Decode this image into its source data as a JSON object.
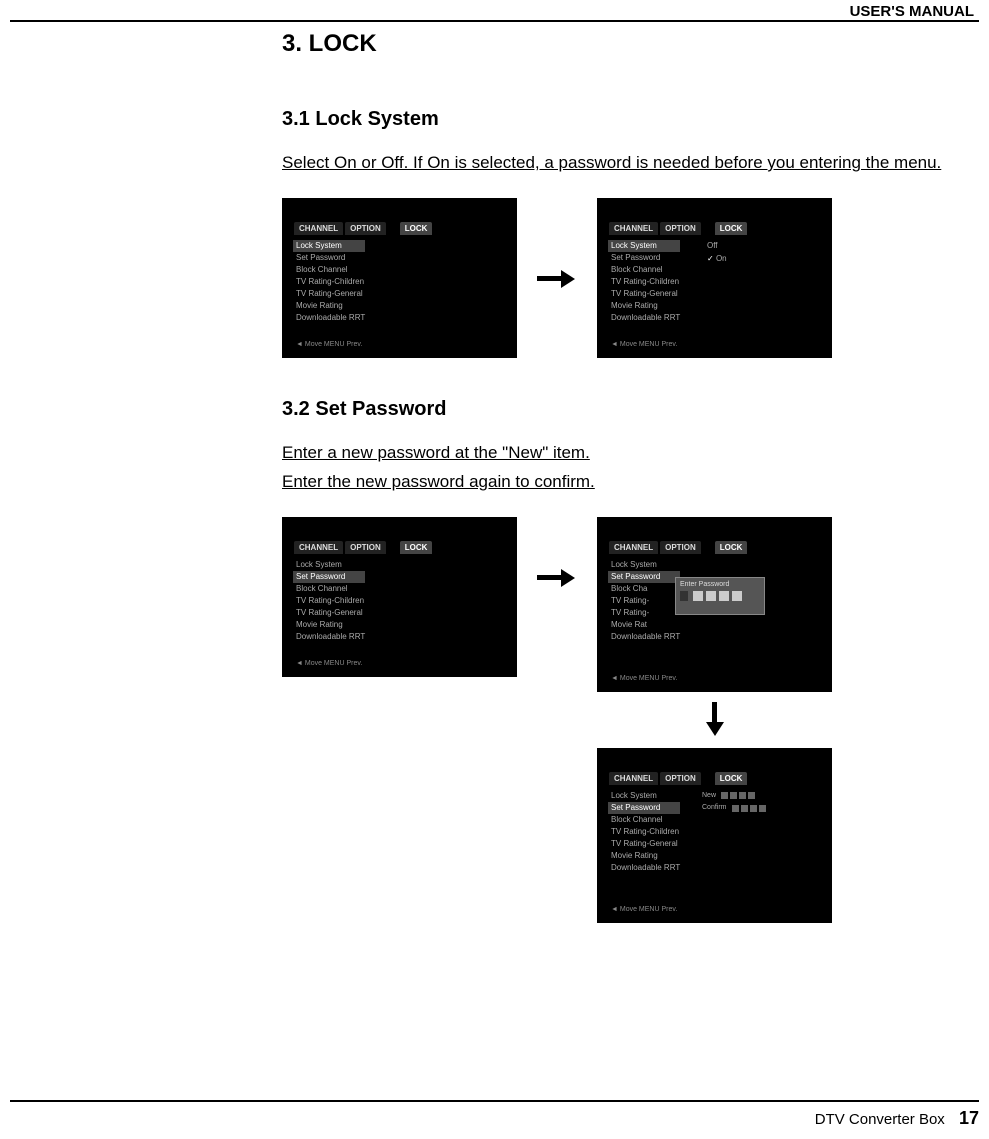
{
  "header": {
    "manual_label": "USER'S MANUAL"
  },
  "section": {
    "title": "3. LOCK",
    "sub1": {
      "title": "3.1 Lock System",
      "desc": "Select On or Off. If On is selected, a password is needed before you entering the menu."
    },
    "sub2": {
      "title": "3.2 Set Password",
      "desc1": "Enter a new password at the \"New\" item.",
      "desc2": "Enter the new password again to confirm."
    }
  },
  "tv_menu": {
    "tabs": {
      "channel": "CHANNEL",
      "option": "OPTION",
      "lock": "LOCK"
    },
    "items": {
      "lock_system": "Lock System",
      "set_password": "Set Password",
      "block_channel": "Block Channel",
      "tv_rating_children": "TV Rating-Children",
      "tv_rating_general": "TV Rating-General",
      "movie_rating": "Movie Rating",
      "downloadable": "Downloadable RRT"
    },
    "options": {
      "off": "Off",
      "on": "On",
      "check": "✓"
    },
    "popup": {
      "title": "Enter Password"
    },
    "confirm_panel": {
      "new": "New",
      "confirm": "Confirm"
    },
    "hint": "◄ Move  MENU Prev."
  },
  "footer": {
    "product": "DTV Converter Box",
    "page": "17"
  }
}
